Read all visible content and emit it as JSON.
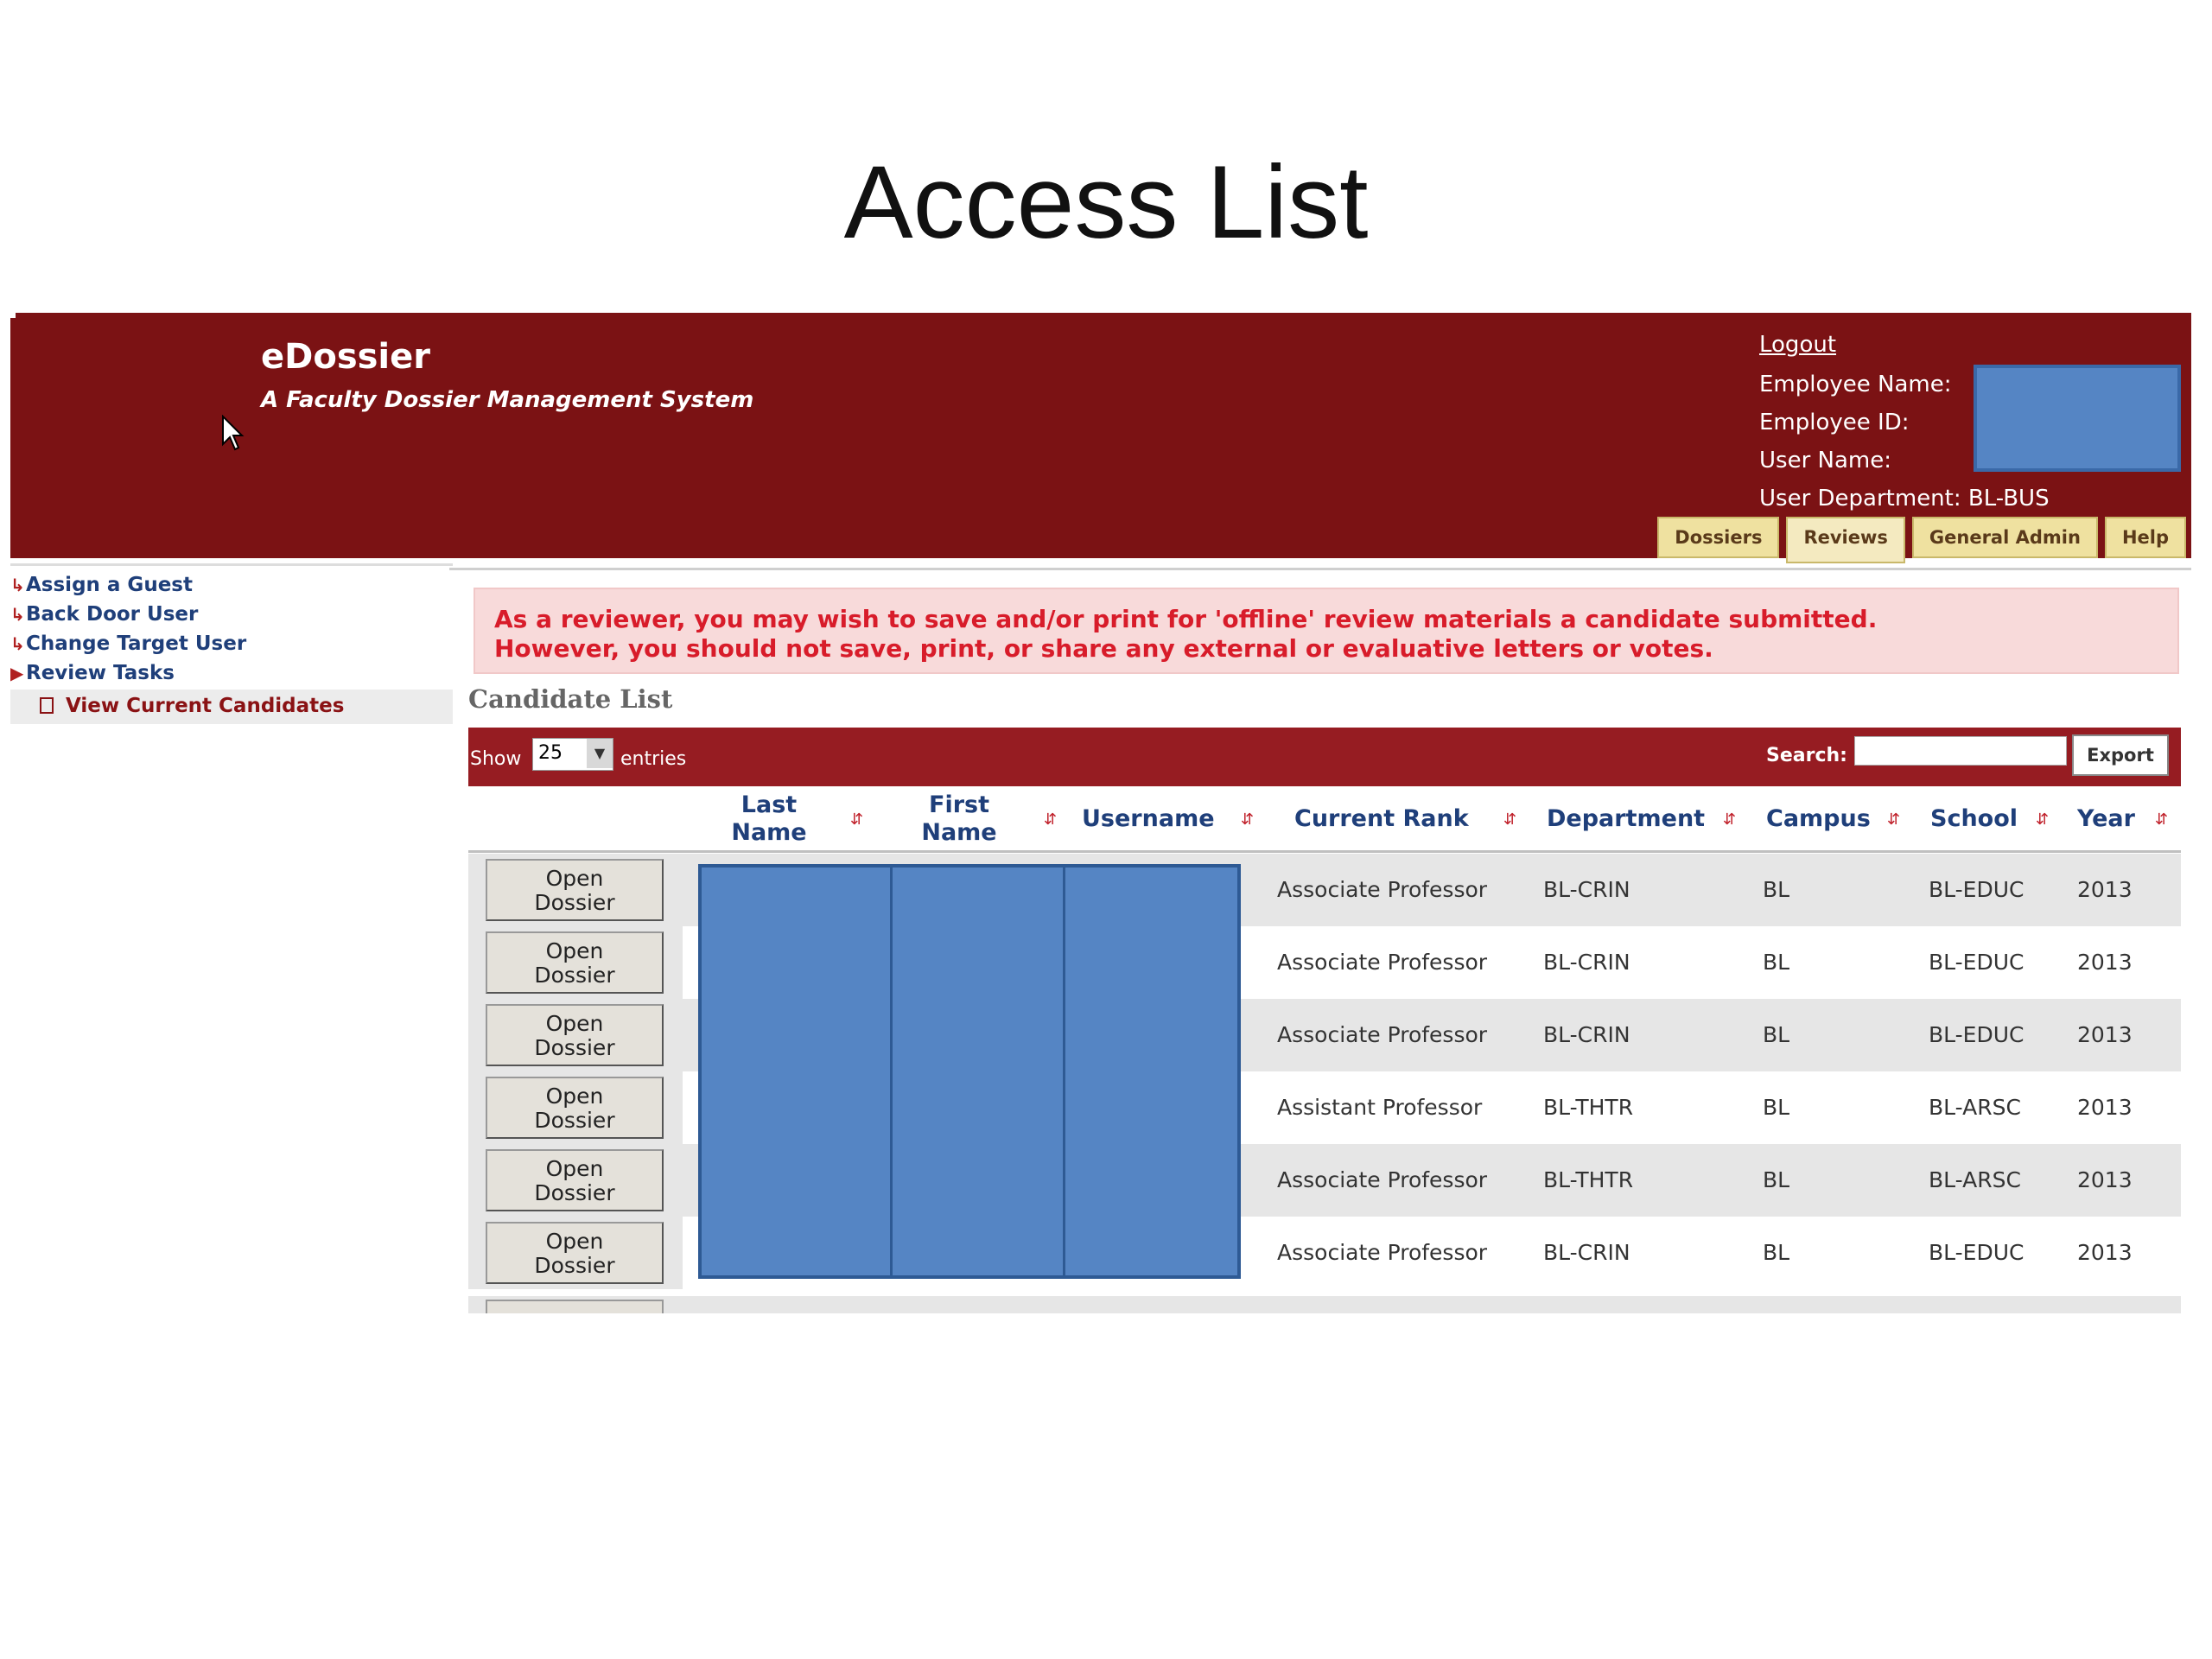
{
  "slide": {
    "title": "Access List"
  },
  "header": {
    "app_name": "eDossier",
    "subtitle": "A Faculty Dossier Management System",
    "logout": "Logout",
    "employee_name_label": "Employee Name:",
    "employee_id_label": "Employee ID:",
    "user_name_label": "User Name:",
    "user_department_label": "User Department:",
    "user_department_value": "BL-BUS",
    "tabs": [
      {
        "label": "Dossiers"
      },
      {
        "label": "Reviews"
      },
      {
        "label": "General Admin"
      },
      {
        "label": "Help"
      }
    ]
  },
  "sidebar": {
    "items": [
      {
        "label": "Assign a Guest"
      },
      {
        "label": "Back Door User"
      },
      {
        "label": "Change Target User"
      },
      {
        "label": "Review Tasks"
      }
    ],
    "sub_item": "View Current Candidates"
  },
  "notice": {
    "line1": "As a reviewer, you may wish to save and/or print for 'offline' review materials a candidate submitted.",
    "line2": "However, you should not save, print, or share any external or evaluative letters or votes."
  },
  "candidate_list": {
    "title": "Candidate List",
    "show_label": "Show",
    "entries_value": "25",
    "entries_label": "entries",
    "search_label": "Search:",
    "search_value": "",
    "export_label": "Export",
    "columns": {
      "last_name_1": "Last",
      "last_name_2": "Name",
      "first_name_1": "First",
      "first_name_2": "Name",
      "username": "Username",
      "current_rank": "Current Rank",
      "department": "Department",
      "campus": "Campus",
      "school": "School",
      "year": "Year"
    },
    "open_button_line1": "Open",
    "open_button_line2": "Dossier",
    "rows": [
      {
        "rank": "Associate Professor",
        "department": "BL-CRIN",
        "campus": "BL",
        "school": "BL-EDUC",
        "year": "2013"
      },
      {
        "rank": "Associate Professor",
        "department": "BL-CRIN",
        "campus": "BL",
        "school": "BL-EDUC",
        "year": "2013"
      },
      {
        "rank": "Associate Professor",
        "department": "BL-CRIN",
        "campus": "BL",
        "school": "BL-EDUC",
        "year": "2013"
      },
      {
        "rank": "Assistant Professor",
        "department": "BL-THTR",
        "campus": "BL",
        "school": "BL-ARSC",
        "year": "2013"
      },
      {
        "rank": "Associate Professor",
        "department": "BL-THTR",
        "campus": "BL",
        "school": "BL-ARSC",
        "year": "2013"
      },
      {
        "rank": "Associate Professor",
        "department": "BL-CRIN",
        "campus": "BL",
        "school": "BL-EDUC",
        "year": "2013"
      }
    ]
  },
  "icons": {
    "cursor": "mouse-pointer-icon",
    "sort": "sort-arrows-icon",
    "sidebar_bullet": "arrow-bullet-icon",
    "document": "document-icon"
  },
  "colors": {
    "header_bg": "#7b1214",
    "toolbar_bg": "#961c22",
    "notice_text": "#d81c2a",
    "notice_bg": "#f8dada",
    "redaction": "#5585c4",
    "link": "#1f3f7a",
    "tab_bg": "#efe1a0"
  }
}
